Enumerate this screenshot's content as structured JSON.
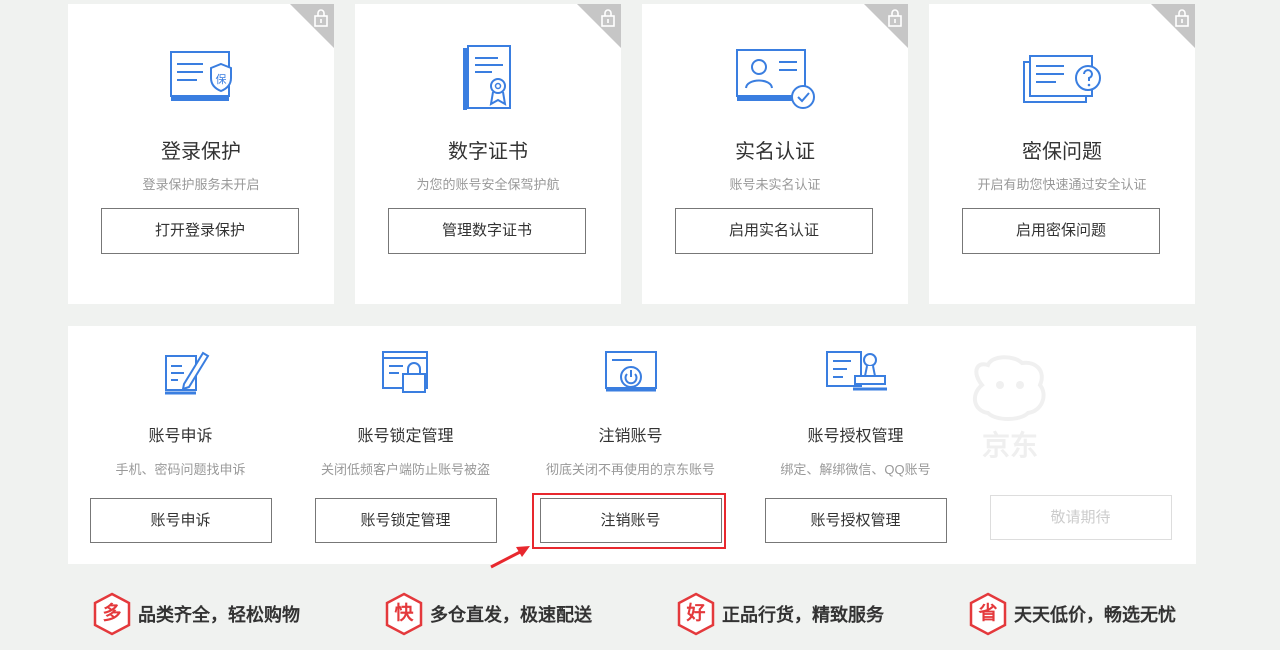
{
  "security_cards": [
    {
      "title": "登录保护",
      "desc": "登录保护服务未开启",
      "button": "打开登录保护",
      "icon": "shield-document-icon"
    },
    {
      "title": "数字证书",
      "desc": "为您的账号安全保驾护航",
      "button": "管理数字证书",
      "icon": "certificate-icon"
    },
    {
      "title": "实名认证",
      "desc": "账号未实名认证",
      "button": "启用实名认证",
      "icon": "id-card-check-icon"
    },
    {
      "title": "密保问题",
      "desc": "开启有助您快速通过安全认证",
      "button": "启用密保问题",
      "icon": "question-cards-icon"
    }
  ],
  "account_services": [
    {
      "title": "账号申诉",
      "desc": "手机、密码问题找申诉",
      "button": "账号申诉",
      "icon": "edit-document-icon"
    },
    {
      "title": "账号锁定管理",
      "desc": "关闭低频客户端防止账号被盗",
      "button": "账号锁定管理",
      "icon": "locked-window-icon"
    },
    {
      "title": "注销账号",
      "desc": "彻底关闭不再使用的京东账号",
      "button": "注销账号",
      "icon": "power-window-icon"
    },
    {
      "title": "账号授权管理",
      "desc": "绑定、解绑微信、QQ账号",
      "button": "账号授权管理",
      "icon": "stamp-document-icon"
    }
  ],
  "coming_soon": {
    "watermark": "京东",
    "button": "敬请期待"
  },
  "promos": [
    {
      "badge": "多",
      "text": "品类齐全，轻松购物"
    },
    {
      "badge": "快",
      "text": "多仓直发，极速配送"
    },
    {
      "badge": "好",
      "text": "正品行货，精致服务"
    },
    {
      "badge": "省",
      "text": "天天低价，畅选无忧"
    }
  ],
  "colors": {
    "accent_blue": "#3a7ee0",
    "highlight_red": "#e8282e",
    "promo_red": "#e4393c",
    "lock_gray": "#c6c6c6"
  }
}
